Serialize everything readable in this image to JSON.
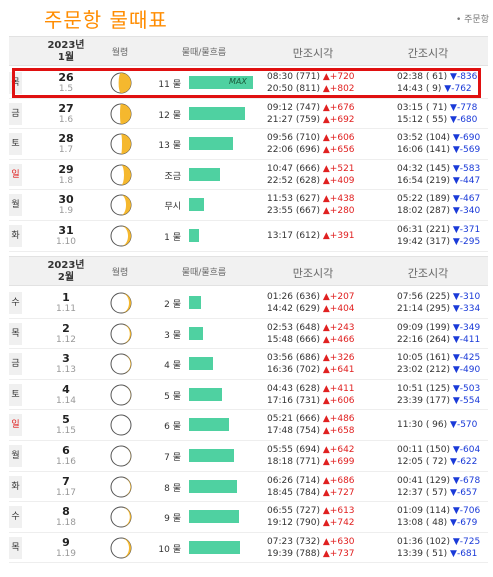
{
  "page": {
    "title": "주문항 물때표",
    "location": "• 주문항"
  },
  "headers": {
    "moon": "월령",
    "tide": "물때/물흐름",
    "high": "만조시각",
    "low": "간조시각"
  },
  "months": [
    {
      "label_year": "2023년",
      "label_month": "1월",
      "rows": [
        {
          "weekday": "목",
          "day": "26",
          "lunar": "1.5",
          "moon_phase": 0.38,
          "tide_label": "11 물",
          "tide_pct": 100,
          "max": "MAX",
          "high": [
            {
              "time": "08:30",
              "level": "(771)",
              "diff": "▲+720",
              "dir": "up"
            },
            {
              "time": "20:50",
              "level": "(811)",
              "diff": "▲+802",
              "dir": "up"
            }
          ],
          "low": [
            {
              "time": "02:38",
              "level": "( 61)",
              "diff": "▼-836",
              "dir": "dn"
            },
            {
              "time": "14:43",
              "level": "(  9)",
              "diff": "▼-762",
              "dir": "dn"
            }
          ]
        },
        {
          "weekday": "금",
          "day": "27",
          "lunar": "1.6",
          "moon_phase": 0.45,
          "tide_label": "12 물",
          "tide_pct": 88,
          "max": "",
          "high": [
            {
              "time": "09:12",
              "level": "(747)",
              "diff": "▲+676",
              "dir": "up"
            },
            {
              "time": "21:27",
              "level": "(759)",
              "diff": "▲+692",
              "dir": "up"
            }
          ],
          "low": [
            {
              "time": "03:15",
              "level": "( 71)",
              "diff": "▼-778",
              "dir": "dn"
            },
            {
              "time": "15:12",
              "level": "( 55)",
              "diff": "▼-680",
              "dir": "dn"
            }
          ]
        },
        {
          "weekday": "토",
          "day": "28",
          "lunar": "1.7",
          "moon_phase": 0.55,
          "tide_label": "13 물",
          "tide_pct": 68,
          "max": "",
          "high": [
            {
              "time": "09:56",
              "level": "(710)",
              "diff": "▲+606",
              "dir": "up"
            },
            {
              "time": "22:06",
              "level": "(696)",
              "diff": "▲+656",
              "dir": "up"
            }
          ],
          "low": [
            {
              "time": "03:52",
              "level": "(104)",
              "diff": "▼-690",
              "dir": "dn"
            },
            {
              "time": "16:06",
              "level": "(141)",
              "diff": "▼-569",
              "dir": "dn"
            }
          ]
        },
        {
          "weekday": "일",
          "day": "29",
          "lunar": "1.8",
          "moon_phase": 0.65,
          "tide_label": "조금",
          "tide_pct": 48,
          "max": "",
          "high": [
            {
              "time": "10:47",
              "level": "(666)",
              "diff": "▲+521",
              "dir": "up"
            },
            {
              "time": "22:52",
              "level": "(628)",
              "diff": "▲+409",
              "dir": "up"
            }
          ],
          "low": [
            {
              "time": "04:32",
              "level": "(145)",
              "diff": "▼-583",
              "dir": "dn"
            },
            {
              "time": "16:54",
              "level": "(219)",
              "diff": "▼-447",
              "dir": "dn"
            }
          ]
        },
        {
          "weekday": "월",
          "day": "30",
          "lunar": "1.9",
          "moon_phase": 0.75,
          "tide_label": "무시",
          "tide_pct": 24,
          "max": "",
          "high": [
            {
              "time": "11:53",
              "level": "(627)",
              "diff": "▲+438",
              "dir": "up"
            },
            {
              "time": "23:55",
              "level": "(667)",
              "diff": "▲+280",
              "dir": "up"
            }
          ],
          "low": [
            {
              "time": "05:22",
              "level": "(189)",
              "diff": "▼-467",
              "dir": "dn"
            },
            {
              "time": "18:02",
              "level": "(287)",
              "diff": "▼-340",
              "dir": "dn"
            }
          ]
        },
        {
          "weekday": "화",
          "day": "31",
          "lunar": "1.10",
          "moon_phase": 0.85,
          "tide_label": "1 물",
          "tide_pct": 15,
          "max": "",
          "high": [
            {
              "time": "13:17",
              "level": "(612)",
              "diff": "▲+391",
              "dir": "up"
            }
          ],
          "low": [
            {
              "time": "06:31",
              "level": "(221)",
              "diff": "▼-371",
              "dir": "dn"
            },
            {
              "time": "19:42",
              "level": "(317)",
              "diff": "▼-295",
              "dir": "dn"
            }
          ]
        }
      ]
    },
    {
      "label_year": "2023년",
      "label_month": "2월",
      "rows": [
        {
          "weekday": "수",
          "day": "1",
          "lunar": "1.11",
          "moon_phase": 0.9,
          "tide_label": "2 물",
          "tide_pct": 18,
          "max": "",
          "high": [
            {
              "time": "01:26",
              "level": "(636)",
              "diff": "▲+207",
              "dir": "up"
            },
            {
              "time": "14:42",
              "level": "(629)",
              "diff": "▲+404",
              "dir": "up"
            }
          ],
          "low": [
            {
              "time": "07:56",
              "level": "(225)",
              "diff": "▼-310",
              "dir": "dn"
            },
            {
              "time": "21:14",
              "level": "(295)",
              "diff": "▼-334",
              "dir": "dn"
            }
          ]
        },
        {
          "weekday": "목",
          "day": "2",
          "lunar": "1.12",
          "moon_phase": 0.94,
          "tide_label": "3 물",
          "tide_pct": 22,
          "max": "",
          "high": [
            {
              "time": "02:53",
              "level": "(648)",
              "diff": "▲+243",
              "dir": "up"
            },
            {
              "time": "15:48",
              "level": "(666)",
              "diff": "▲+466",
              "dir": "up"
            }
          ],
          "low": [
            {
              "time": "09:09",
              "level": "(199)",
              "diff": "▼-349",
              "dir": "dn"
            },
            {
              "time": "22:16",
              "level": "(264)",
              "diff": "▼-411",
              "dir": "dn"
            }
          ]
        },
        {
          "weekday": "금",
          "day": "3",
          "lunar": "1.13",
          "moon_phase": 0.97,
          "tide_label": "4 물",
          "tide_pct": 38,
          "max": "",
          "high": [
            {
              "time": "03:56",
              "level": "(686)",
              "diff": "▲+326",
              "dir": "up"
            },
            {
              "time": "16:36",
              "level": "(702)",
              "diff": "▲+641",
              "dir": "up"
            }
          ],
          "low": [
            {
              "time": "10:05",
              "level": "(161)",
              "diff": "▼-425",
              "dir": "dn"
            },
            {
              "time": "23:02",
              "level": "(212)",
              "diff": "▼-490",
              "dir": "dn"
            }
          ]
        },
        {
          "weekday": "토",
          "day": "4",
          "lunar": "1.14",
          "moon_phase": 0.99,
          "tide_label": "5 물",
          "tide_pct": 52,
          "max": "",
          "high": [
            {
              "time": "04:43",
              "level": "(628)",
              "diff": "▲+411",
              "dir": "up"
            },
            {
              "time": "17:16",
              "level": "(731)",
              "diff": "▲+606",
              "dir": "up"
            }
          ],
          "low": [
            {
              "time": "10:51",
              "level": "(125)",
              "diff": "▼-503",
              "dir": "dn"
            },
            {
              "time": "23:39",
              "level": "(177)",
              "diff": "▼-554",
              "dir": "dn"
            }
          ]
        },
        {
          "weekday": "일",
          "day": "5",
          "lunar": "1.15",
          "moon_phase": 1.0,
          "tide_label": "6 물",
          "tide_pct": 62,
          "max": "",
          "high": [
            {
              "time": "05:21",
              "level": "(666)",
              "diff": "▲+486",
              "dir": "up"
            },
            {
              "time": "17:48",
              "level": "(754)",
              "diff": "▲+658",
              "dir": "up"
            }
          ],
          "low": [
            {
              "time": "11:30",
              "level": "( 96)",
              "diff": "▼-570",
              "dir": "dn"
            }
          ]
        },
        {
          "weekday": "월",
          "day": "6",
          "lunar": "1.16",
          "moon_phase": 0.99,
          "tide_label": "7 물",
          "tide_pct": 70,
          "max": "",
          "high": [
            {
              "time": "05:55",
              "level": "(694)",
              "diff": "▲+642",
              "dir": "up"
            },
            {
              "time": "18:18",
              "level": "(771)",
              "diff": "▲+699",
              "dir": "up"
            }
          ],
          "low": [
            {
              "time": "00:11",
              "level": "(150)",
              "diff": "▼-604",
              "dir": "dn"
            },
            {
              "time": "12:05",
              "level": "( 72)",
              "diff": "▼-622",
              "dir": "dn"
            }
          ]
        },
        {
          "weekday": "화",
          "day": "7",
          "lunar": "1.17",
          "moon_phase": 0.97,
          "tide_label": "8 물",
          "tide_pct": 75,
          "max": "",
          "high": [
            {
              "time": "06:26",
              "level": "(714)",
              "diff": "▲+686",
              "dir": "up"
            },
            {
              "time": "18:45",
              "level": "(784)",
              "diff": "▲+727",
              "dir": "up"
            }
          ],
          "low": [
            {
              "time": "00:41",
              "level": "(129)",
              "diff": "▼-678",
              "dir": "dn"
            },
            {
              "time": "12:37",
              "level": "( 57)",
              "diff": "▼-657",
              "dir": "dn"
            }
          ]
        },
        {
          "weekday": "수",
          "day": "8",
          "lunar": "1.18",
          "moon_phase": 0.94,
          "tide_label": "9 물",
          "tide_pct": 78,
          "max": "",
          "high": [
            {
              "time": "06:55",
              "level": "(727)",
              "diff": "▲+613",
              "dir": "up"
            },
            {
              "time": "19:12",
              "level": "(790)",
              "diff": "▲+742",
              "dir": "up"
            }
          ],
          "low": [
            {
              "time": "01:09",
              "level": "(114)",
              "diff": "▼-706",
              "dir": "dn"
            },
            {
              "time": "13:08",
              "level": "( 48)",
              "diff": "▼-679",
              "dir": "dn"
            }
          ]
        },
        {
          "weekday": "목",
          "day": "9",
          "lunar": "1.19",
          "moon_phase": 0.9,
          "tide_label": "10 물",
          "tide_pct": 80,
          "max": "",
          "high": [
            {
              "time": "07:23",
              "level": "(732)",
              "diff": "▲+630",
              "dir": "up"
            },
            {
              "time": "19:39",
              "level": "(788)",
              "diff": "▲+737",
              "dir": "up"
            }
          ],
          "low": [
            {
              "time": "01:36",
              "level": "(102)",
              "diff": "▼-725",
              "dir": "dn"
            },
            {
              "time": "13:39",
              "level": "( 51)",
              "diff": "▼-681",
              "dir": "dn"
            }
          ]
        }
      ]
    }
  ]
}
